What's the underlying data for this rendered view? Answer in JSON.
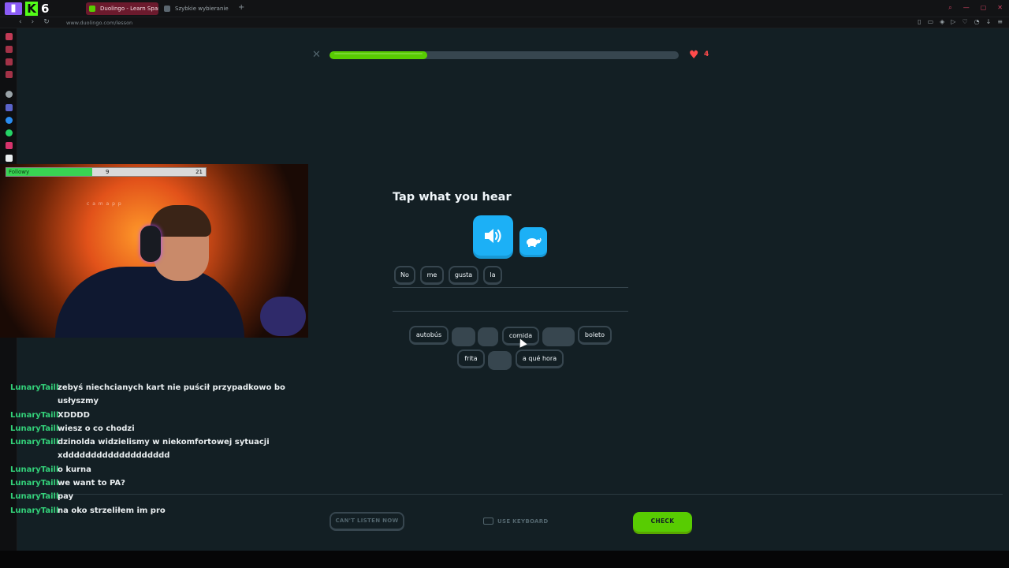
{
  "browser": {
    "tabs": [
      {
        "label": "Duolingo - Learn Span",
        "active": true
      },
      {
        "label": "Szybkie wybieranie",
        "active": false
      }
    ],
    "url": "www.duolingo.com/lesson",
    "brand_marks": {
      "kick_letter": "K",
      "number": "6"
    }
  },
  "lesson": {
    "progress": 0.28,
    "hearts": "4",
    "prompt": "Tap what you hear",
    "answer_words": [
      "No",
      "me",
      "gusta",
      "la"
    ],
    "word_bank_row1": [
      "autobús",
      "",
      "",
      "comida",
      "",
      "boleto"
    ],
    "word_bank_row2": [
      "frita",
      "",
      "a qué hora"
    ],
    "cant_listen": "CAN'T LISTEN NOW",
    "use_keyboard": "USE KEYBOARD",
    "check": "CHECK"
  },
  "overlay": {
    "follow_label": "Followy",
    "follow_count": "9",
    "follow_goal": "21",
    "follow_fraction": 0.43,
    "watermark": "c a m   a p p"
  },
  "chat": [
    {
      "user": "LunaryTaill",
      "text": "zebyś niechcianych kart nie puścił przypadkowo bo usłyszmy"
    },
    {
      "user": "LunaryTaill",
      "text": "XDDDD"
    },
    {
      "user": "LunaryTaill",
      "text": "wiesz o co chodzi"
    },
    {
      "user": "LunaryTaill",
      "text": "dzinolda widzielismy w niekomfortowej sytuacji xddddddddddddddddddd"
    },
    {
      "user": "LunaryTaill",
      "text": "o kurna"
    },
    {
      "user": "LunaryTaill",
      "text": "we want to PA?"
    },
    {
      "user": "LunaryTaill",
      "text": "pay"
    },
    {
      "user": "LunaryTaill",
      "text": "na oko strzeliłem im pro"
    }
  ],
  "colors": {
    "page_bg": "#131f24",
    "accent_green": "#58cc02",
    "accent_blue": "#1cb0f6",
    "heart_red": "#ff4b4b",
    "chat_user": "#33d27a"
  }
}
